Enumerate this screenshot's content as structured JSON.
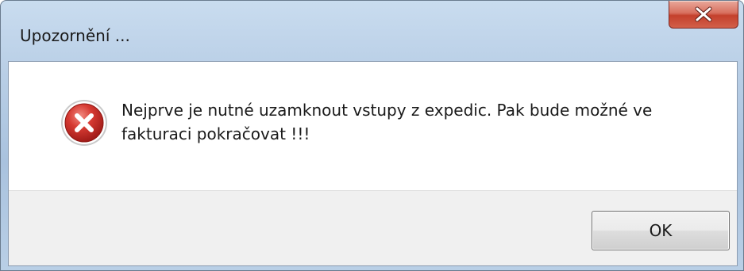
{
  "window": {
    "title": "Upozornění ...",
    "close_icon": "close-x-icon"
  },
  "dialog": {
    "icon": "error-icon",
    "message": "Nejprve je nutné uzamknout vstupy z expedic. Pak bude možné ve fakturaci pokračovat !!!",
    "ok_label": "OK"
  },
  "colors": {
    "close_button": "#c4402c",
    "error_icon": "#c8262b",
    "button_area": "#f0f0f0"
  }
}
